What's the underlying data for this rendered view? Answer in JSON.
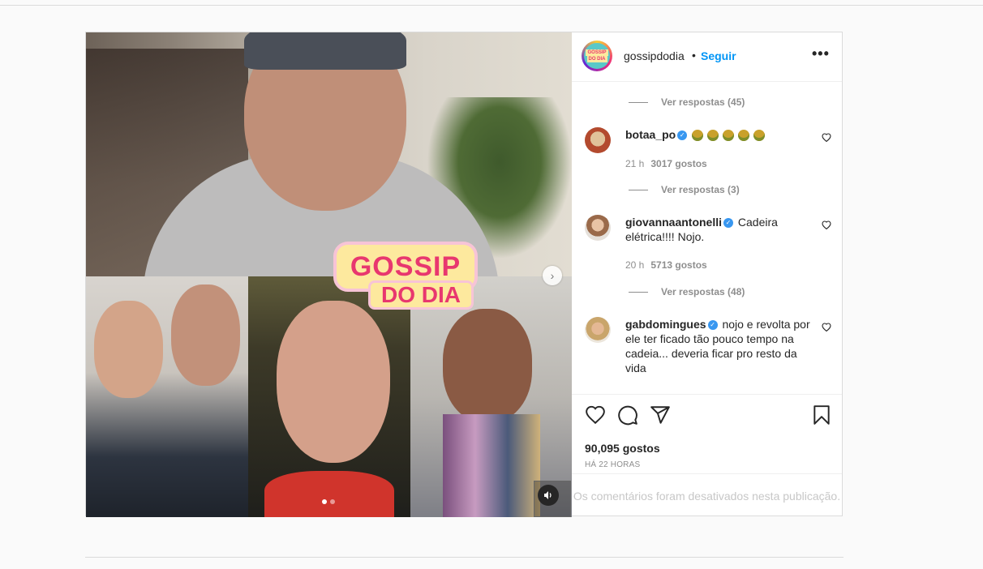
{
  "header": {
    "username": "gossipdodia",
    "separator": "•",
    "follow_label": "Seguir",
    "more_label": "•••"
  },
  "media": {
    "logo_top": "GOSSIP",
    "logo_bottom": "DO DIA",
    "next_label": "›",
    "carousel_active_index": 0,
    "carousel_count": 2,
    "sound_icon": "speaker-icon"
  },
  "comments": [
    {
      "replies_label": "Ver respostas (45)"
    },
    {
      "username": "botaa_po",
      "verified": true,
      "text": "",
      "emoji_count": 5,
      "time": "21 h",
      "likes": "3017 gostos",
      "replies_label": "Ver respostas (3)"
    },
    {
      "username": "giovannaantonelli",
      "verified": true,
      "text": "Cadeira elétrica!!!! Nojo.",
      "time": "20 h",
      "likes": "5713 gostos",
      "replies_label": "Ver respostas (48)"
    },
    {
      "username": "gabdomingues",
      "verified": true,
      "text": "nojo e revolta por ele ter ficado tão pouco tempo na cadeia... deveria ficar pro resto da vida"
    }
  ],
  "actions": {
    "likes": "90,095 gostos",
    "time_ago": "HÁ 22 HORAS",
    "comments_disabled": "Os comentários foram desativados nesta publicação.",
    "icons": [
      "heart-icon",
      "comment-icon",
      "share-icon",
      "bookmark-icon"
    ]
  },
  "colors": {
    "accent": "#0095f6",
    "verified": "#3897f0",
    "border": "#dbdbdb"
  }
}
